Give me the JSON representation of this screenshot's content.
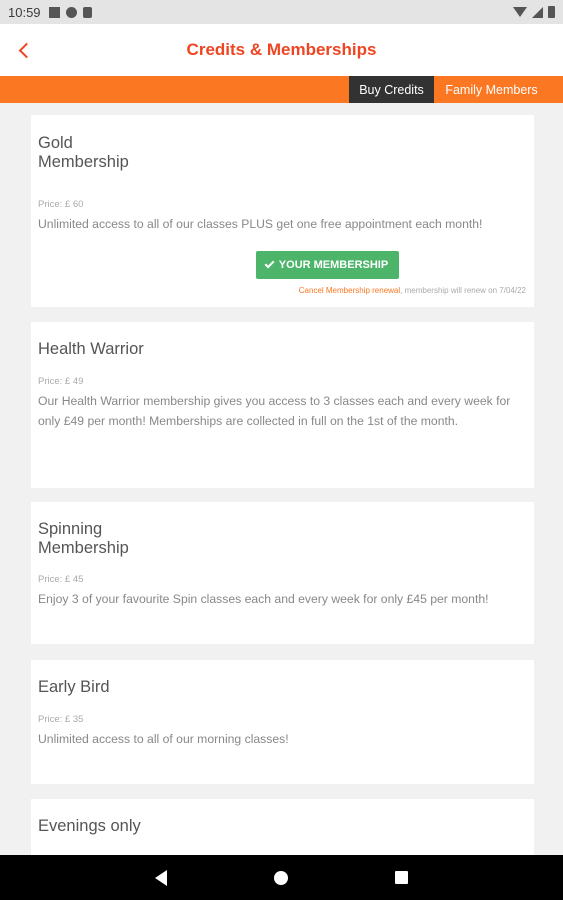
{
  "status_bar": {
    "time": "10:59"
  },
  "header": {
    "title": "Credits & Memberships"
  },
  "tabs": {
    "buy_credits": "Buy Credits",
    "family_members": "Family Members"
  },
  "memberships": [
    {
      "name": "Gold\nMembership",
      "price": "Price: £ 60",
      "description": "Unlimited access to all of our classes PLUS get one free appointment each month!",
      "button_label": "YOUR MEMBERSHIP",
      "cancel_link": "Cancel Membership renewal",
      "renew_note": ", membership will renew on 7/04/22"
    },
    {
      "name": "Health Warrior",
      "price": "Price: £ 49",
      "description": "Our Health Warrior membership gives you access to 3 classes each and every week for only £49 per month! Memberships are collected in full on the 1st of the month."
    },
    {
      "name": "Spinning\nMembership",
      "price": "Price: £ 45",
      "description": "Enjoy 3 of your favourite Spin classes each and every week for only £45 per month!"
    },
    {
      "name": "Early Bird",
      "price": "Price: £ 35",
      "description": "Unlimited access to all of our morning classes!"
    },
    {
      "name": "Evenings only"
    }
  ],
  "icons": {
    "back": "chevron-left-icon",
    "status": [
      "notification-icon",
      "sync-icon",
      "sd-card-icon",
      "wifi-icon",
      "signal-icon",
      "battery-icon"
    ],
    "nav": [
      "nav-back-icon",
      "nav-home-icon",
      "nav-recents-icon"
    ]
  },
  "colors": {
    "accent": "#ee4522",
    "tab_bar": "#fb7722",
    "active_tab": "#323232",
    "membership_button": "#4cb56a"
  }
}
